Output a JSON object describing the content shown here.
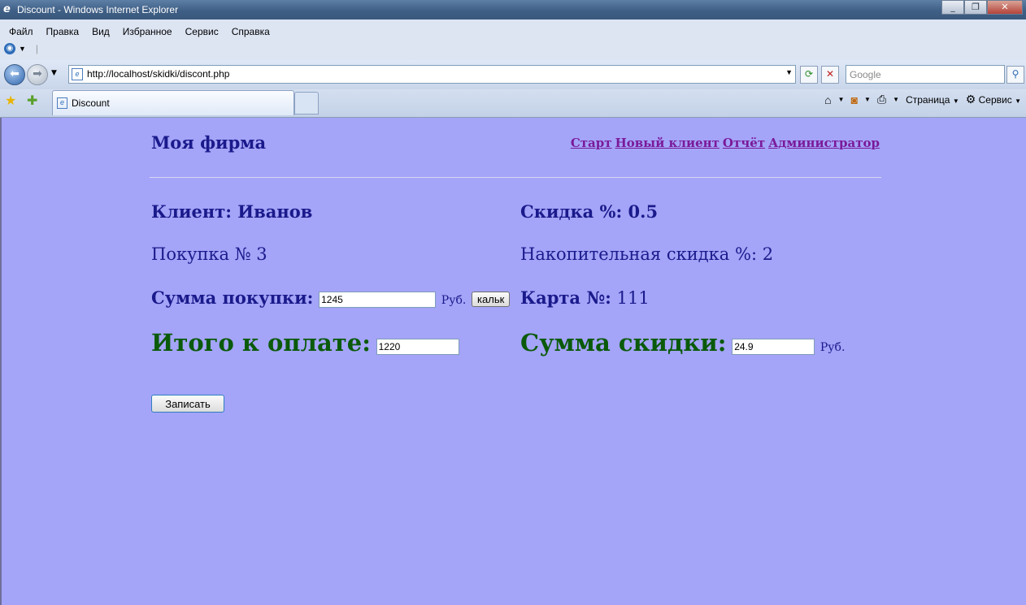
{
  "window": {
    "title": "Discount - Windows Internet Explorer",
    "buttons": [
      "_",
      "❐",
      "✕"
    ]
  },
  "menu": [
    "Файл",
    "Правка",
    "Вид",
    "Избранное",
    "Сервис",
    "Справка"
  ],
  "address": {
    "url": "http://localhost/skidki/discont.php"
  },
  "search": {
    "placeholder": "Google"
  },
  "tab": {
    "label": "Discount"
  },
  "commandbar": {
    "page": "Страница",
    "tools": "Сервис"
  },
  "page": {
    "brand": "Моя фирма",
    "nav": [
      "Старт",
      "Новый клиент",
      "Отчёт",
      "Администратор"
    ],
    "client_label": "Клиент: Иванов",
    "discount_label": "Скидка %: 0.5",
    "purchase_no": "Покупка № 3",
    "cumulative": "Накопительная скидка %: 2",
    "sum_label": "Сумма покупки:",
    "sum_value": "1245",
    "unit": "Руб.",
    "calc_button": "кальк",
    "card_label": "Карта №:",
    "card_value": "111",
    "total_label": "Итого к оплате:",
    "total_value": "1220",
    "discount_sum_label": "Сумма скидки:",
    "discount_sum_value": "24.9",
    "save_button": "Записать"
  }
}
